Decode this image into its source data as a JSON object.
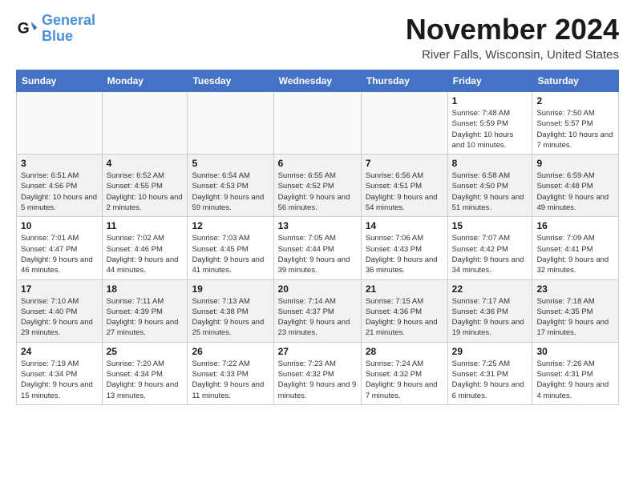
{
  "logo": {
    "line1": "General",
    "line2": "Blue"
  },
  "title": "November 2024",
  "location": "River Falls, Wisconsin, United States",
  "weekdays": [
    "Sunday",
    "Monday",
    "Tuesday",
    "Wednesday",
    "Thursday",
    "Friday",
    "Saturday"
  ],
  "weeks": [
    [
      {
        "day": "",
        "info": ""
      },
      {
        "day": "",
        "info": ""
      },
      {
        "day": "",
        "info": ""
      },
      {
        "day": "",
        "info": ""
      },
      {
        "day": "",
        "info": ""
      },
      {
        "day": "1",
        "info": "Sunrise: 7:48 AM\nSunset: 5:59 PM\nDaylight: 10 hours and 10 minutes."
      },
      {
        "day": "2",
        "info": "Sunrise: 7:50 AM\nSunset: 5:57 PM\nDaylight: 10 hours and 7 minutes."
      }
    ],
    [
      {
        "day": "3",
        "info": "Sunrise: 6:51 AM\nSunset: 4:56 PM\nDaylight: 10 hours and 5 minutes."
      },
      {
        "day": "4",
        "info": "Sunrise: 6:52 AM\nSunset: 4:55 PM\nDaylight: 10 hours and 2 minutes."
      },
      {
        "day": "5",
        "info": "Sunrise: 6:54 AM\nSunset: 4:53 PM\nDaylight: 9 hours and 59 minutes."
      },
      {
        "day": "6",
        "info": "Sunrise: 6:55 AM\nSunset: 4:52 PM\nDaylight: 9 hours and 56 minutes."
      },
      {
        "day": "7",
        "info": "Sunrise: 6:56 AM\nSunset: 4:51 PM\nDaylight: 9 hours and 54 minutes."
      },
      {
        "day": "8",
        "info": "Sunrise: 6:58 AM\nSunset: 4:50 PM\nDaylight: 9 hours and 51 minutes."
      },
      {
        "day": "9",
        "info": "Sunrise: 6:59 AM\nSunset: 4:48 PM\nDaylight: 9 hours and 49 minutes."
      }
    ],
    [
      {
        "day": "10",
        "info": "Sunrise: 7:01 AM\nSunset: 4:47 PM\nDaylight: 9 hours and 46 minutes."
      },
      {
        "day": "11",
        "info": "Sunrise: 7:02 AM\nSunset: 4:46 PM\nDaylight: 9 hours and 44 minutes."
      },
      {
        "day": "12",
        "info": "Sunrise: 7:03 AM\nSunset: 4:45 PM\nDaylight: 9 hours and 41 minutes."
      },
      {
        "day": "13",
        "info": "Sunrise: 7:05 AM\nSunset: 4:44 PM\nDaylight: 9 hours and 39 minutes."
      },
      {
        "day": "14",
        "info": "Sunrise: 7:06 AM\nSunset: 4:43 PM\nDaylight: 9 hours and 36 minutes."
      },
      {
        "day": "15",
        "info": "Sunrise: 7:07 AM\nSunset: 4:42 PM\nDaylight: 9 hours and 34 minutes."
      },
      {
        "day": "16",
        "info": "Sunrise: 7:09 AM\nSunset: 4:41 PM\nDaylight: 9 hours and 32 minutes."
      }
    ],
    [
      {
        "day": "17",
        "info": "Sunrise: 7:10 AM\nSunset: 4:40 PM\nDaylight: 9 hours and 29 minutes."
      },
      {
        "day": "18",
        "info": "Sunrise: 7:11 AM\nSunset: 4:39 PM\nDaylight: 9 hours and 27 minutes."
      },
      {
        "day": "19",
        "info": "Sunrise: 7:13 AM\nSunset: 4:38 PM\nDaylight: 9 hours and 25 minutes."
      },
      {
        "day": "20",
        "info": "Sunrise: 7:14 AM\nSunset: 4:37 PM\nDaylight: 9 hours and 23 minutes."
      },
      {
        "day": "21",
        "info": "Sunrise: 7:15 AM\nSunset: 4:36 PM\nDaylight: 9 hours and 21 minutes."
      },
      {
        "day": "22",
        "info": "Sunrise: 7:17 AM\nSunset: 4:36 PM\nDaylight: 9 hours and 19 minutes."
      },
      {
        "day": "23",
        "info": "Sunrise: 7:18 AM\nSunset: 4:35 PM\nDaylight: 9 hours and 17 minutes."
      }
    ],
    [
      {
        "day": "24",
        "info": "Sunrise: 7:19 AM\nSunset: 4:34 PM\nDaylight: 9 hours and 15 minutes."
      },
      {
        "day": "25",
        "info": "Sunrise: 7:20 AM\nSunset: 4:34 PM\nDaylight: 9 hours and 13 minutes."
      },
      {
        "day": "26",
        "info": "Sunrise: 7:22 AM\nSunset: 4:33 PM\nDaylight: 9 hours and 11 minutes."
      },
      {
        "day": "27",
        "info": "Sunrise: 7:23 AM\nSunset: 4:32 PM\nDaylight: 9 hours and 9 minutes."
      },
      {
        "day": "28",
        "info": "Sunrise: 7:24 AM\nSunset: 4:32 PM\nDaylight: 9 hours and 7 minutes."
      },
      {
        "day": "29",
        "info": "Sunrise: 7:25 AM\nSunset: 4:31 PM\nDaylight: 9 hours and 6 minutes."
      },
      {
        "day": "30",
        "info": "Sunrise: 7:26 AM\nSunset: 4:31 PM\nDaylight: 9 hours and 4 minutes."
      }
    ]
  ]
}
